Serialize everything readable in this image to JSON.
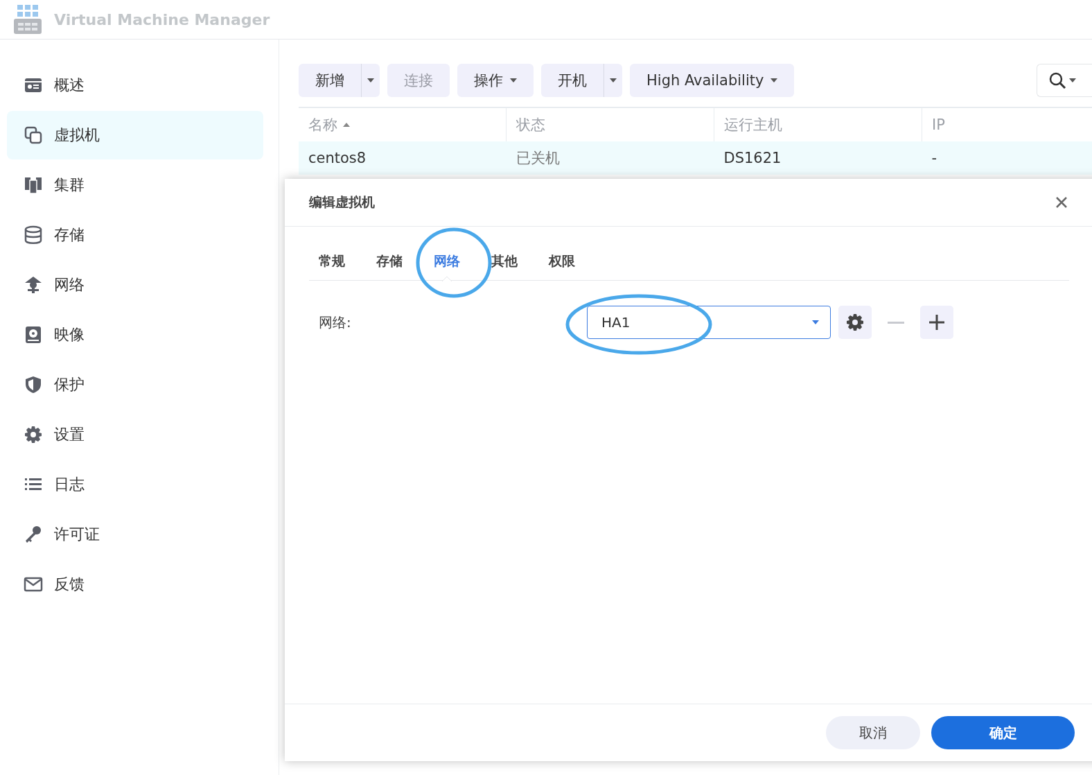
{
  "app": {
    "title": "Virtual Machine Manager"
  },
  "sidebar": {
    "items": [
      {
        "label": "概述",
        "selected": false
      },
      {
        "label": "虚拟机",
        "selected": true
      },
      {
        "label": "集群",
        "selected": false
      },
      {
        "label": "存储",
        "selected": false
      },
      {
        "label": "网络",
        "selected": false
      },
      {
        "label": "映像",
        "selected": false
      },
      {
        "label": "保护",
        "selected": false
      },
      {
        "label": "设置",
        "selected": false
      },
      {
        "label": "日志",
        "selected": false
      },
      {
        "label": "许可证",
        "selected": false
      },
      {
        "label": "反馈",
        "selected": false
      }
    ]
  },
  "toolbar": {
    "buttons": [
      {
        "label": "新增",
        "kind": "split",
        "disabled": false
      },
      {
        "label": "连接",
        "kind": "plain",
        "disabled": true
      },
      {
        "label": "操作",
        "kind": "dropdown",
        "disabled": false
      },
      {
        "label": "开机",
        "kind": "split",
        "disabled": false
      },
      {
        "label": "High Availability",
        "kind": "dropdown",
        "disabled": false
      }
    ]
  },
  "table": {
    "columns": [
      {
        "label": "名称",
        "sorted": true
      },
      {
        "label": "状态",
        "sorted": false
      },
      {
        "label": "运行主机",
        "sorted": false
      },
      {
        "label": "IP",
        "sorted": false
      }
    ],
    "rows": [
      {
        "cells": [
          "centos8",
          "已关机",
          "DS1621",
          "-"
        ],
        "selected": true
      }
    ]
  },
  "dialog": {
    "title": "编辑虚拟机",
    "tabs": [
      {
        "label": "常规",
        "selected": false
      },
      {
        "label": "存储",
        "selected": false
      },
      {
        "label": "网络",
        "selected": true
      },
      {
        "label": "其他",
        "selected": false
      },
      {
        "label": "权限",
        "selected": false
      }
    ],
    "field": {
      "label": "网络:",
      "value": "HA1"
    },
    "actions": [
      {
        "kind": "settings",
        "disabled": false
      },
      {
        "kind": "remove",
        "disabled": true
      },
      {
        "kind": "add",
        "disabled": false
      }
    ],
    "buttons": [
      {
        "label": "取消",
        "kind": "secondary"
      },
      {
        "label": "确定",
        "kind": "primary"
      }
    ]
  }
}
